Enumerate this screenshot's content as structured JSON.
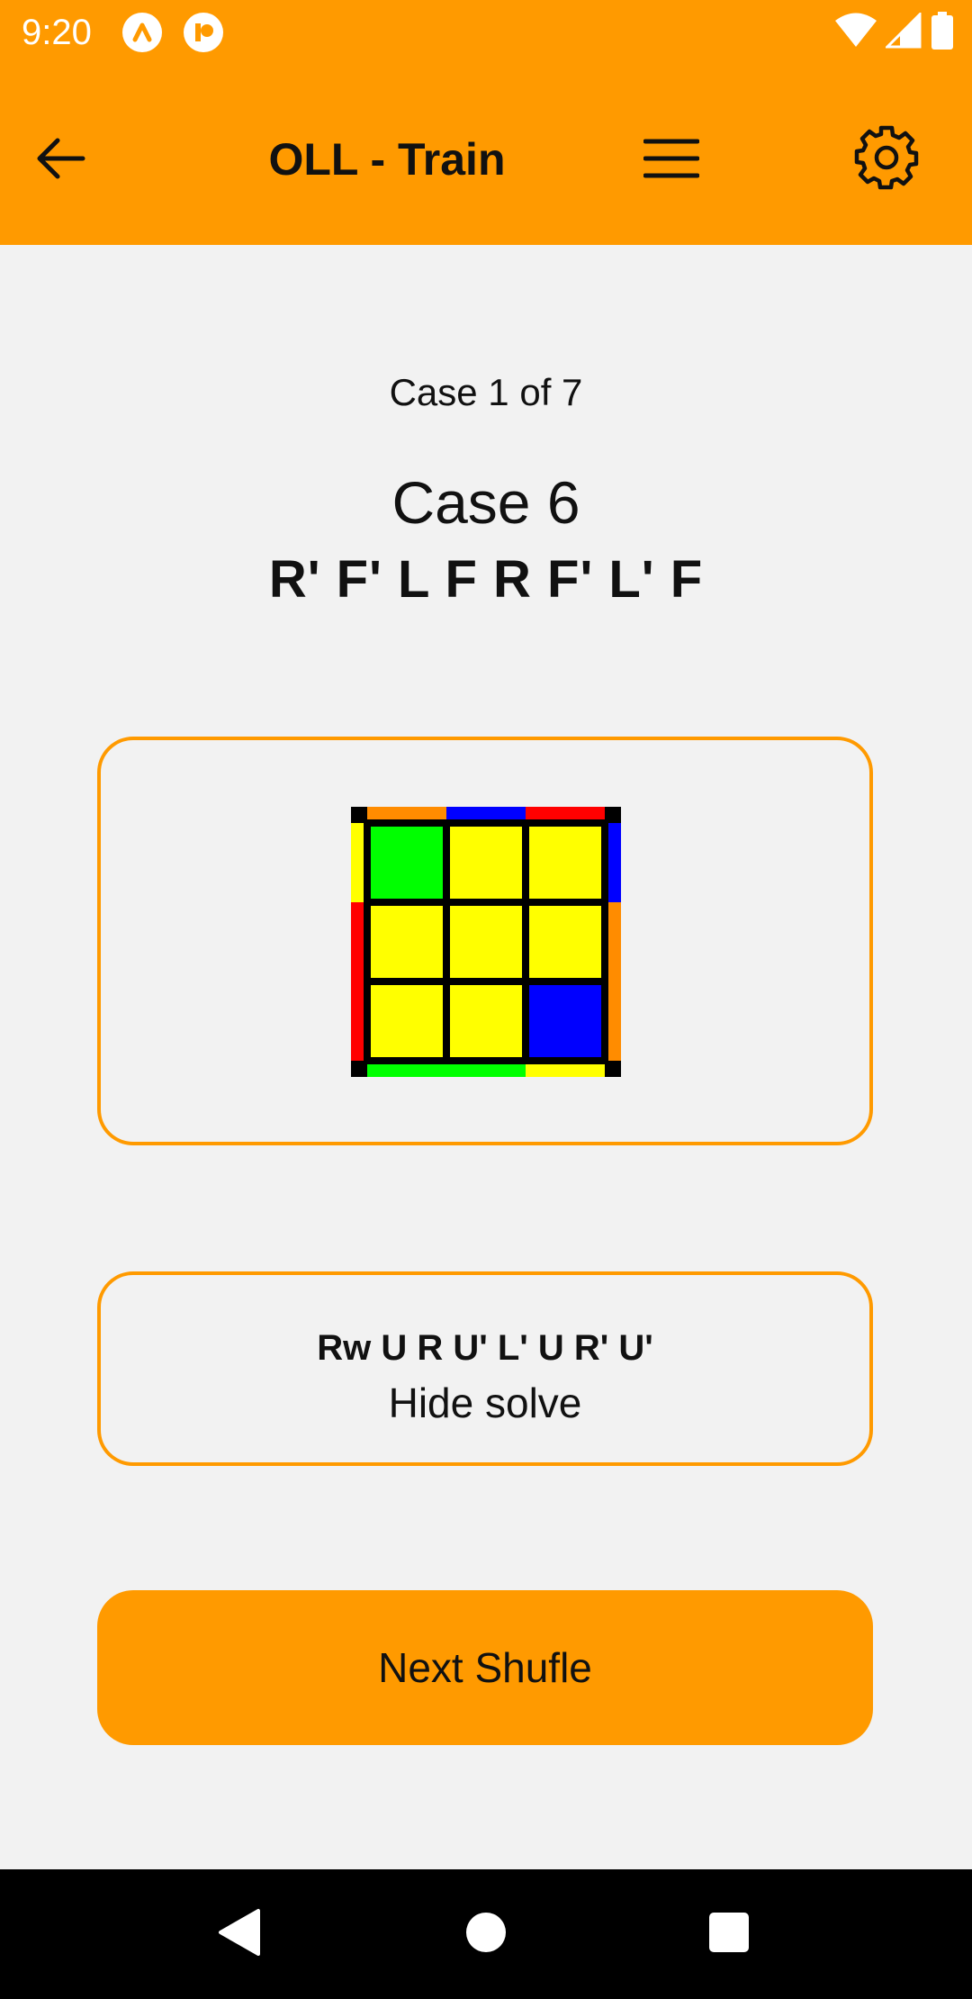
{
  "status_bar": {
    "time": "9:20",
    "icons": [
      "app-notification-icon",
      "app-notification-icon",
      "wifi-icon",
      "cell-signal-icon",
      "battery-icon"
    ]
  },
  "app_bar": {
    "title": "OLL - Train",
    "icons": [
      "back-arrow-icon",
      "menu-icon",
      "gear-icon"
    ]
  },
  "content": {
    "counter": "Case 1 of 7",
    "case_name": "Case 6",
    "scramble": "R' F' L F R F' L' F",
    "solve_algorithm": "Rw U R U' L' U R' U'",
    "solve_toggle": "Hide solve",
    "next_button": "Next Shufle"
  },
  "diagram": {
    "top_face": [
      [
        "green",
        "yellow",
        "yellow"
      ],
      [
        "yellow",
        "yellow",
        "yellow"
      ],
      [
        "yellow",
        "yellow",
        "blue"
      ]
    ],
    "side_top": [
      "orange",
      "blue",
      "red"
    ],
    "side_bottom": [
      "green",
      "green",
      "yellow"
    ],
    "side_left": [
      "yellow",
      "red",
      "red"
    ],
    "side_right": [
      "blue",
      "orange",
      "orange"
    ]
  },
  "colors": {
    "accent": "#ff9a00",
    "background": "#f2f2f2",
    "nav_bar": "#000000",
    "sticker_colors": {
      "yellow": "#ffff00",
      "green": "#00ff00",
      "blue": "#0000ff",
      "red": "#ff0000",
      "orange": "#ff8c00"
    }
  },
  "nav_bar": {
    "icons": [
      "back-triangle-icon",
      "home-circle-icon",
      "recents-square-icon"
    ]
  }
}
